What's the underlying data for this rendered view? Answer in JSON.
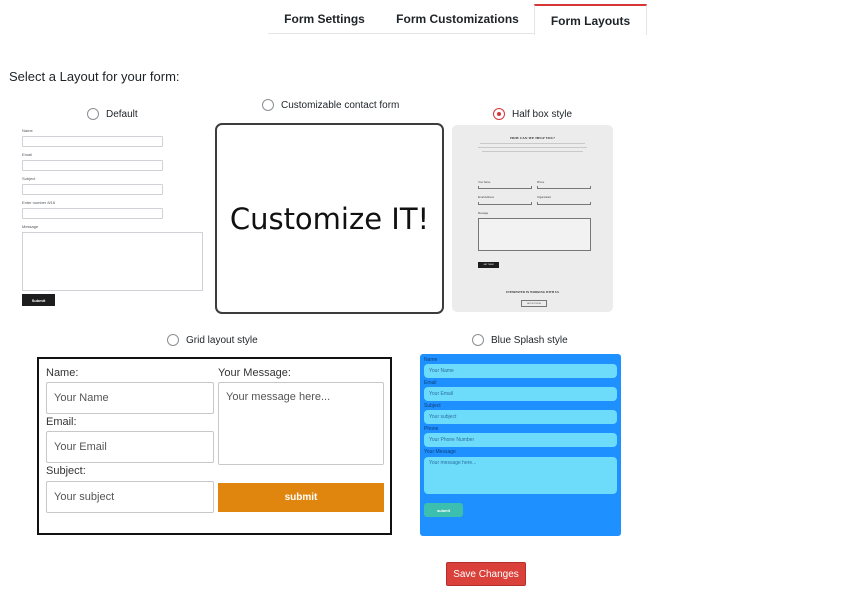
{
  "tabs": [
    {
      "label": "Form Settings",
      "active": false
    },
    {
      "label": "Form Customizations",
      "active": false
    },
    {
      "label": "Form Layouts",
      "active": true
    }
  ],
  "page_title": "Select a Layout for your form:",
  "layouts": {
    "default": {
      "label": "Default",
      "selected": false
    },
    "customizable": {
      "label": "Customizable contact form",
      "selected": false,
      "preview_text": "Customize IT!"
    },
    "halfbox": {
      "label": "Half box style",
      "selected": true
    },
    "grid": {
      "label": "Grid layout style",
      "selected": false
    },
    "bluesplash": {
      "label": "Blue Splash style",
      "selected": false
    }
  },
  "default_preview": {
    "name_label": "Name",
    "email_label": "Email",
    "subject_label": "Subject",
    "number_label": "Enter number 8/16",
    "message_label": "Message",
    "submit": "Submit"
  },
  "halfbox_preview": {
    "title": "HOW CAN WE HELP YOU?",
    "name_label": "Your Name",
    "phone_label": "Phone",
    "email_label": "Email Address",
    "org_label": "Organization",
    "message_label": "Message",
    "submit": "GET THEM",
    "footer": "INTERESTED IN WORKING WITH US",
    "footer_button": "GET IN TOUCH"
  },
  "grid_preview": {
    "name_label": "Name:",
    "email_label": "Email:",
    "subject_label": "Subject:",
    "message_label": "Your Message:",
    "name_placeholder": "Your Name",
    "email_placeholder": "Your Email",
    "subject_placeholder": "Your subject",
    "message_placeholder": "Your message here...",
    "submit": "submit"
  },
  "blue_preview": {
    "name_label": "Name",
    "email_label": "Email",
    "subject_label": "Subject",
    "phone_label": "Phone",
    "message_label": "Your Message",
    "name_placeholder": "Your Name",
    "email_placeholder": "Your Email",
    "subject_placeholder": "Your subject",
    "phone_placeholder": "Your Phone Number",
    "message_placeholder": "Your message here...",
    "submit": "submit"
  },
  "save_button": "Save Changes",
  "colors": {
    "accent": "#d63638",
    "save_button": "#d9413a",
    "grid_submit": "#e0850d",
    "blue_bg": "#1e90ff",
    "blue_input": "#6ddcfa"
  }
}
